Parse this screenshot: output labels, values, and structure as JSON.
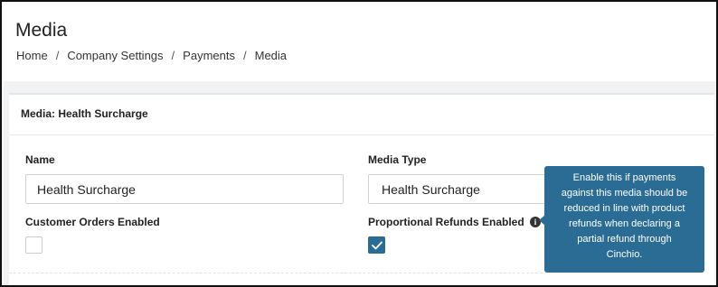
{
  "page": {
    "title": "Media"
  },
  "breadcrumb": {
    "items": [
      "Home",
      "Company Settings",
      "Payments",
      "Media"
    ],
    "separator": "/"
  },
  "card": {
    "title": "Media: Health Surcharge"
  },
  "form": {
    "name_label": "Name",
    "name_value": "Health Surcharge",
    "media_type_label": "Media Type",
    "media_type_value": "Health Surcharge",
    "customer_orders_label": "Customer Orders Enabled",
    "customer_orders_checked": false,
    "proportional_refunds_label": "Proportional Refunds Enabled",
    "proportional_refunds_checked": true
  },
  "tooltip": {
    "lines": [
      "Enable this if payments",
      "against this media should be",
      "reduced in line with product",
      "refunds when declaring a",
      "partial refund through",
      "Cinchio."
    ]
  },
  "colors": {
    "accent": "#2b6c94",
    "background_grey": "#f1f2f4",
    "border": "#cfd3d8"
  },
  "icons": {
    "info": "info-icon",
    "check": "check-icon"
  }
}
